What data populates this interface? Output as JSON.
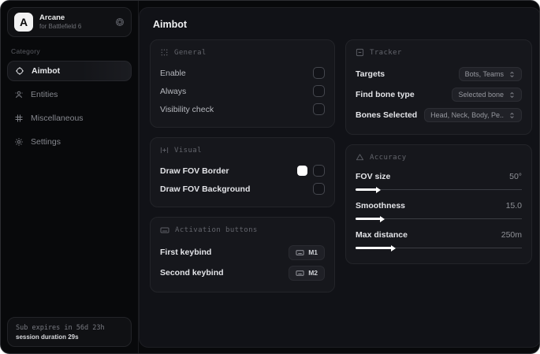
{
  "app": {
    "logo_letter": "A",
    "name": "Arcane",
    "subtitle": "for Battlefield 6"
  },
  "sidebar": {
    "category_label": "Category",
    "items": [
      {
        "label": "Aimbot",
        "active": true
      },
      {
        "label": "Entities",
        "active": false
      },
      {
        "label": "Miscellaneous",
        "active": false
      },
      {
        "label": "Settings",
        "active": false
      }
    ],
    "subscription": {
      "expires_text": "Sub expires in 56d 23h",
      "session_text": "session duration 29s"
    }
  },
  "main": {
    "title": "Aimbot",
    "panels": {
      "general": {
        "title": "General",
        "rows": [
          {
            "label": "Enable",
            "checked": false
          },
          {
            "label": "Always",
            "checked": false
          },
          {
            "label": "Visibility check",
            "checked": false
          }
        ]
      },
      "visual": {
        "title": "Visual",
        "rows": [
          {
            "label": "Draw FOV Border",
            "swatch_color": "#ffffff",
            "checked": false
          },
          {
            "label": "Draw FOV Background",
            "checked": false
          }
        ]
      },
      "activation": {
        "title": "Activation buttons",
        "rows": [
          {
            "label": "First keybind",
            "key": "M1"
          },
          {
            "label": "Second keybind",
            "key": "M2"
          }
        ]
      },
      "tracker": {
        "title": "Tracker",
        "rows": [
          {
            "label": "Targets",
            "value": "Bots, Teams"
          },
          {
            "label": "Find bone type",
            "value": "Selected bone"
          },
          {
            "label": "Bones Selected",
            "value": "Head, Neck, Body, Pe.."
          }
        ]
      },
      "accuracy": {
        "title": "Accuracy",
        "rows": [
          {
            "label": "FOV size",
            "value": "50°",
            "percent": 13
          },
          {
            "label": "Smoothness",
            "value": "15.0",
            "percent": 15
          },
          {
            "label": "Max distance",
            "value": "250m",
            "percent": 22
          }
        ]
      }
    }
  },
  "colors": {
    "window_bg": "#08090b",
    "panel_bg": "#16171c",
    "accent": "#ffffff",
    "fov_border_swatch": "#ffffff"
  }
}
